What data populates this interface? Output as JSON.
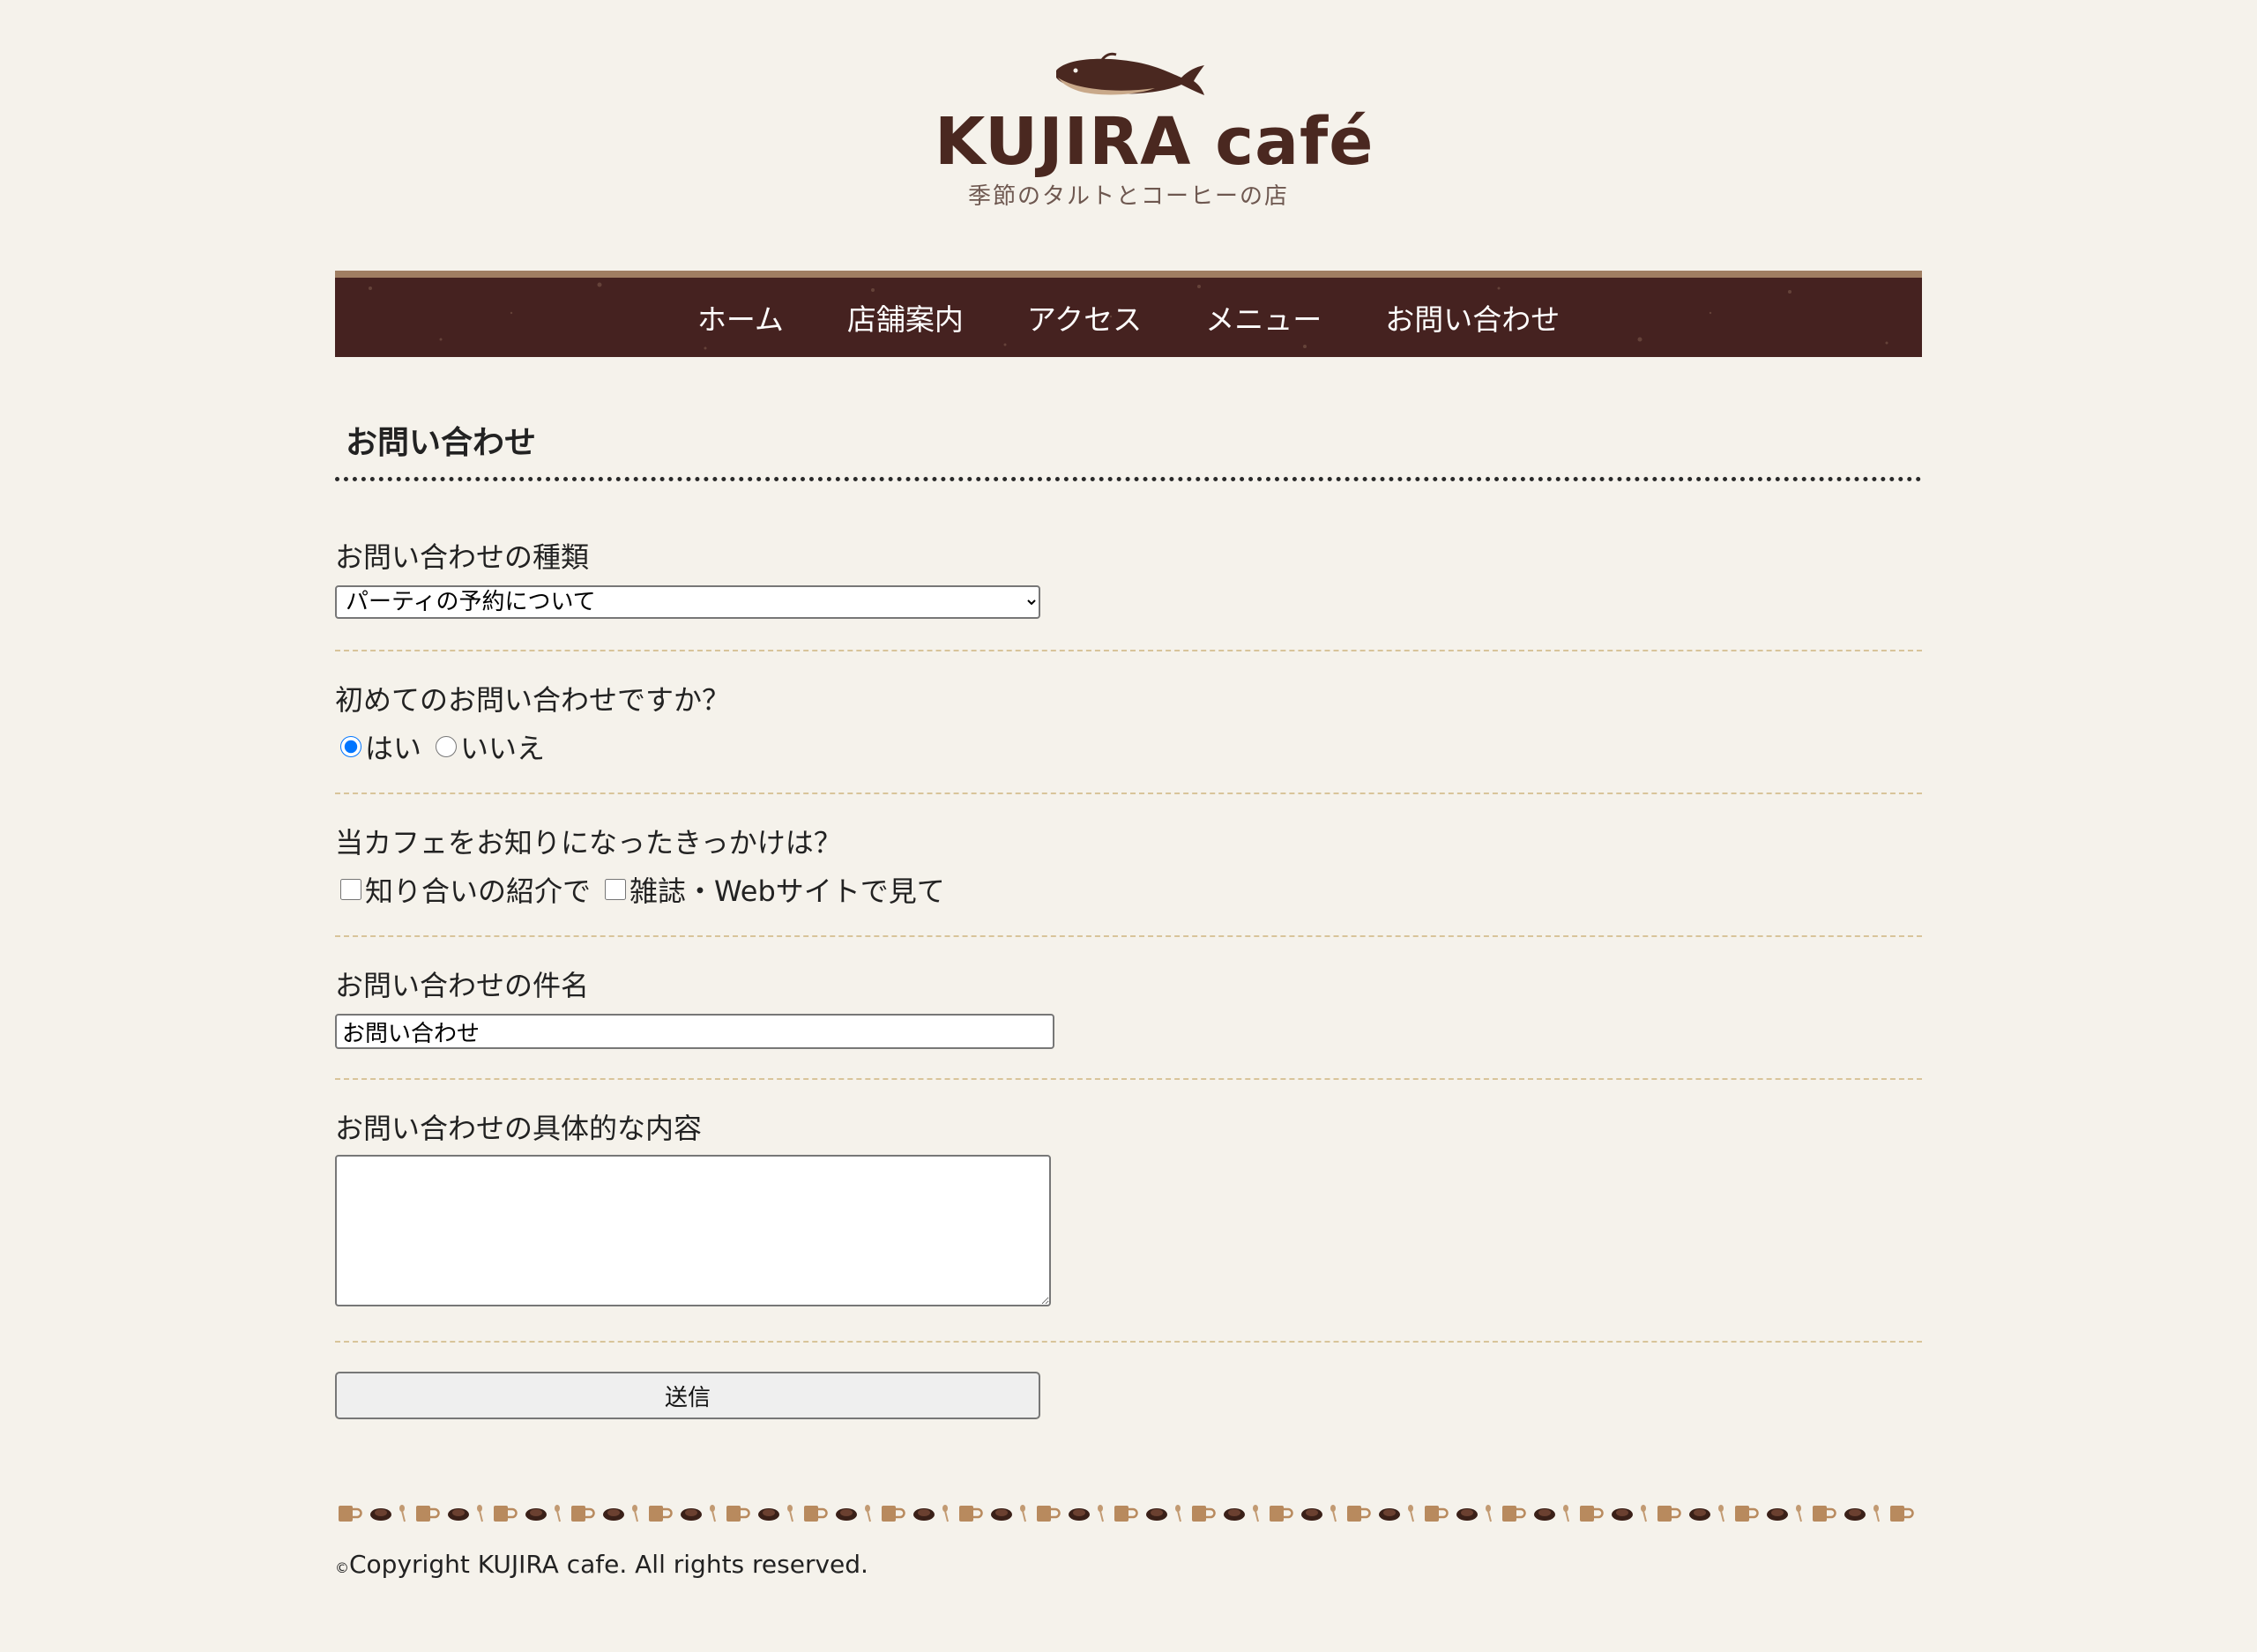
{
  "header": {
    "logo_brand": "KUJIRA café",
    "logo_tagline": "季節のタルトとコーヒーの店"
  },
  "nav": {
    "items": [
      "ホーム",
      "店舗案内",
      "アクセス",
      "メニュー",
      "お問い合わせ"
    ]
  },
  "page": {
    "title": "お問い合わせ"
  },
  "form": {
    "type_label": "お問い合わせの種類",
    "type_selected": "パーティの予約について",
    "first_time_label": "初めてのお問い合わせですか？",
    "first_time_yes": "はい",
    "first_time_no": "いいえ",
    "first_time_value": "yes",
    "source_label": "当カフェをお知りになったきっかけは？",
    "source_option_1": "知り合いの紹介で",
    "source_option_2": "雑誌・Webサイトで見て",
    "subject_label": "お問い合わせの件名",
    "subject_value": "お問い合わせ",
    "details_label": "お問い合わせの具体的な内容",
    "details_value": "",
    "submit_label": "送信"
  },
  "footer": {
    "copyright_symbol": "©",
    "copyright_text": "Copyright KUJIRA cafe. All rights reserved."
  },
  "colors": {
    "background": "#f5f2eb",
    "nav_bg": "#452220",
    "brand": "#4a2820",
    "separator": "#d8c49a"
  }
}
